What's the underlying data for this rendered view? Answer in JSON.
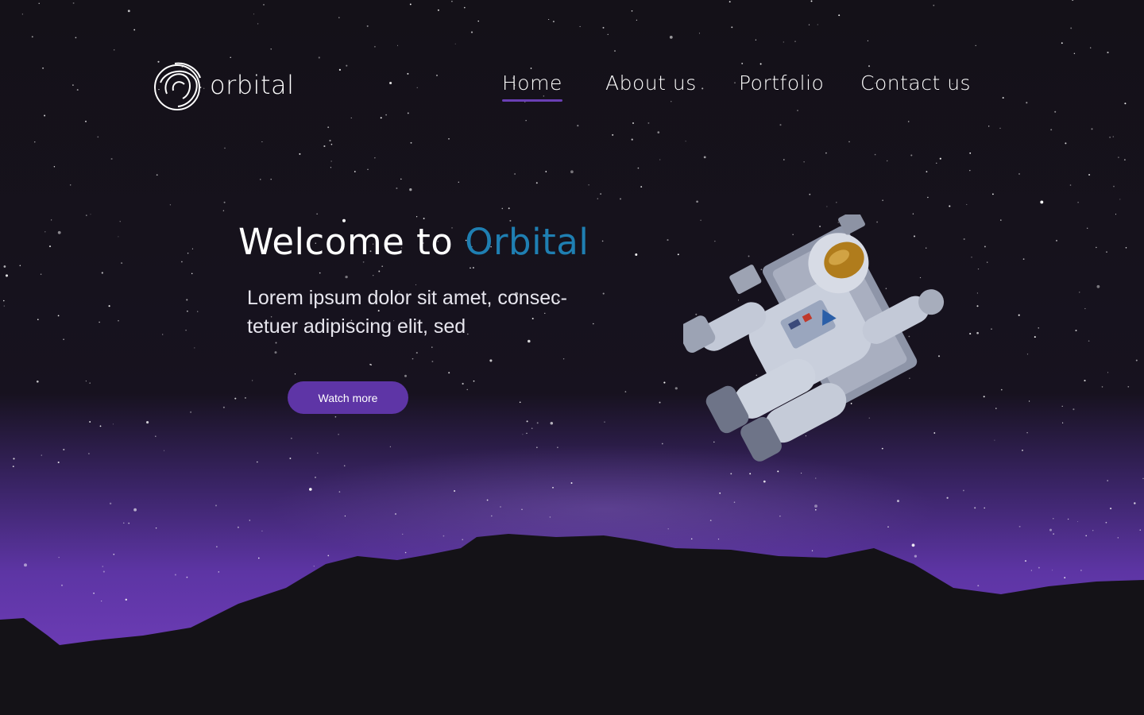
{
  "brand": {
    "name": "orbital",
    "logo_icon": "orbital-swirl-logo"
  },
  "nav": {
    "items": [
      {
        "label": "Home",
        "active": true
      },
      {
        "label": "About us",
        "active": false
      },
      {
        "label": "Portfolio",
        "active": false
      },
      {
        "label": "Contact us",
        "active": false
      }
    ]
  },
  "hero": {
    "title_prefix": "Welcome to ",
    "title_accent": "Orbital",
    "subtitle_line1": "Lorem ipsum dolor sit amet, consec-",
    "subtitle_line2": "tetuer adipiscing elit, sed",
    "cta_label": "Watch more",
    "illustration": "astronaut-icon"
  },
  "colors": {
    "background": "#121017",
    "accent_blue": "#1f7fb2",
    "accent_purple": "#5e35a6",
    "horizon_glow": "#6a3fb5"
  }
}
